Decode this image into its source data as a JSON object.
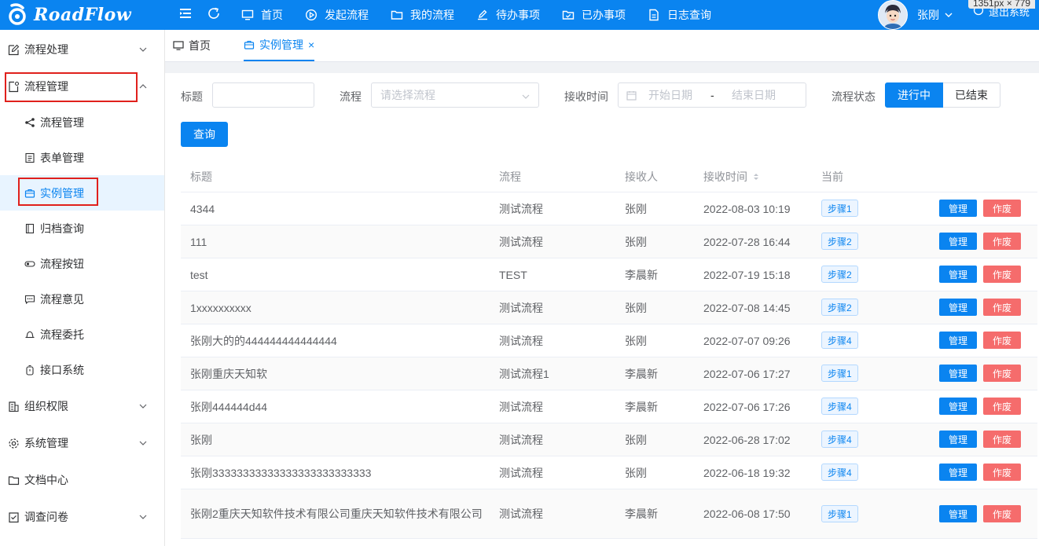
{
  "app": {
    "logo_text": "RoadFlow",
    "dim_tip": "1351px × 779"
  },
  "colors": {
    "primary": "#0a84f0",
    "danger": "#f56c6c",
    "highlight": "#e0201c",
    "tag_bg": "#ecf5ff"
  },
  "topnav": [
    {
      "label": "首页",
      "icon": "monitor-icon"
    },
    {
      "label": "发起流程",
      "icon": "play-circle-icon"
    },
    {
      "label": "我的流程",
      "icon": "folder-icon"
    },
    {
      "label": "待办事项",
      "icon": "edit-icon"
    },
    {
      "label": "已办事项",
      "icon": "folder-check-icon"
    },
    {
      "label": "日志查询",
      "icon": "document-icon"
    }
  ],
  "user": {
    "name": "张刚",
    "logout": "退出系统"
  },
  "sidebar": {
    "groups": [
      {
        "label": "流程处理",
        "icon": "edit-icon"
      },
      {
        "label": "流程管理",
        "icon": "file-settings-icon"
      },
      {
        "label": "组织权限",
        "icon": "building-icon"
      },
      {
        "label": "系统管理",
        "icon": "gear-icon"
      },
      {
        "label": "文档中心",
        "icon": "folder-icon"
      },
      {
        "label": "调查问卷",
        "icon": "checklist-icon"
      }
    ],
    "subitems": [
      {
        "label": "流程管理",
        "icon": "share-icon"
      },
      {
        "label": "表单管理",
        "icon": "form-icon"
      },
      {
        "label": "实例管理",
        "icon": "briefcase-icon"
      },
      {
        "label": "归档查询",
        "icon": "archive-icon"
      },
      {
        "label": "流程按钮",
        "icon": "toggle-icon"
      },
      {
        "label": "流程意见",
        "icon": "comment-icon"
      },
      {
        "label": "流程委托",
        "icon": "bell-icon"
      },
      {
        "label": "接口系统",
        "icon": "stopwatch-icon"
      }
    ]
  },
  "tabs": [
    {
      "label": "首页",
      "icon": "monitor-icon"
    },
    {
      "label": "实例管理",
      "icon": "briefcase-icon",
      "close": "×"
    }
  ],
  "filters": {
    "title_label": "标题",
    "title_value": "",
    "flow_label": "流程",
    "flow_placeholder": "请选择流程",
    "time_label": "接收时间",
    "start_placeholder": "开始日期",
    "date_sep": "-",
    "end_placeholder": "结束日期",
    "status_label": "流程状态",
    "status_options": [
      "进行中",
      "已结束"
    ],
    "search_button": "查询"
  },
  "table": {
    "columns": [
      "标题",
      "流程",
      "接收人",
      "接收时间",
      "当前"
    ],
    "action_manage": "管理",
    "action_void": "作废",
    "rows": [
      {
        "title": "4344",
        "flow": "测试流程",
        "receiver": "张刚",
        "time": "2022-08-03 10:19",
        "step": "步骤1"
      },
      {
        "title": "111",
        "flow": "测试流程",
        "receiver": "张刚",
        "time": "2022-07-28 16:44",
        "step": "步骤2"
      },
      {
        "title": "test",
        "flow": "TEST",
        "receiver": "李晨新",
        "time": "2022-07-19 15:18",
        "step": "步骤2"
      },
      {
        "title": "1xxxxxxxxxx",
        "flow": "测试流程",
        "receiver": "张刚",
        "time": "2022-07-08 14:45",
        "step": "步骤2"
      },
      {
        "title": "张刚大的的444444444444444",
        "flow": "测试流程",
        "receiver": "张刚",
        "time": "2022-07-07 09:26",
        "step": "步骤4"
      },
      {
        "title": "张刚重庆天知软",
        "flow": "测试流程1",
        "receiver": "李晨新",
        "time": "2022-07-06 17:27",
        "step": "步骤1"
      },
      {
        "title": "张刚444444d44",
        "flow": "测试流程",
        "receiver": "李晨新",
        "time": "2022-07-06 17:26",
        "step": "步骤4"
      },
      {
        "title": "张刚",
        "flow": "测试流程",
        "receiver": "张刚",
        "time": "2022-06-28 17:02",
        "step": "步骤4"
      },
      {
        "title": "张刚33333333333333333333333333",
        "flow": "测试流程",
        "receiver": "张刚",
        "time": "2022-06-18 19:32",
        "step": "步骤4"
      },
      {
        "title": "张刚2重庆天知软件技术有限公司重庆天知软件技术有限公司",
        "flow": "测试流程",
        "receiver": "李晨新",
        "time": "2022-06-08 17:50",
        "step": "步骤1"
      }
    ]
  }
}
